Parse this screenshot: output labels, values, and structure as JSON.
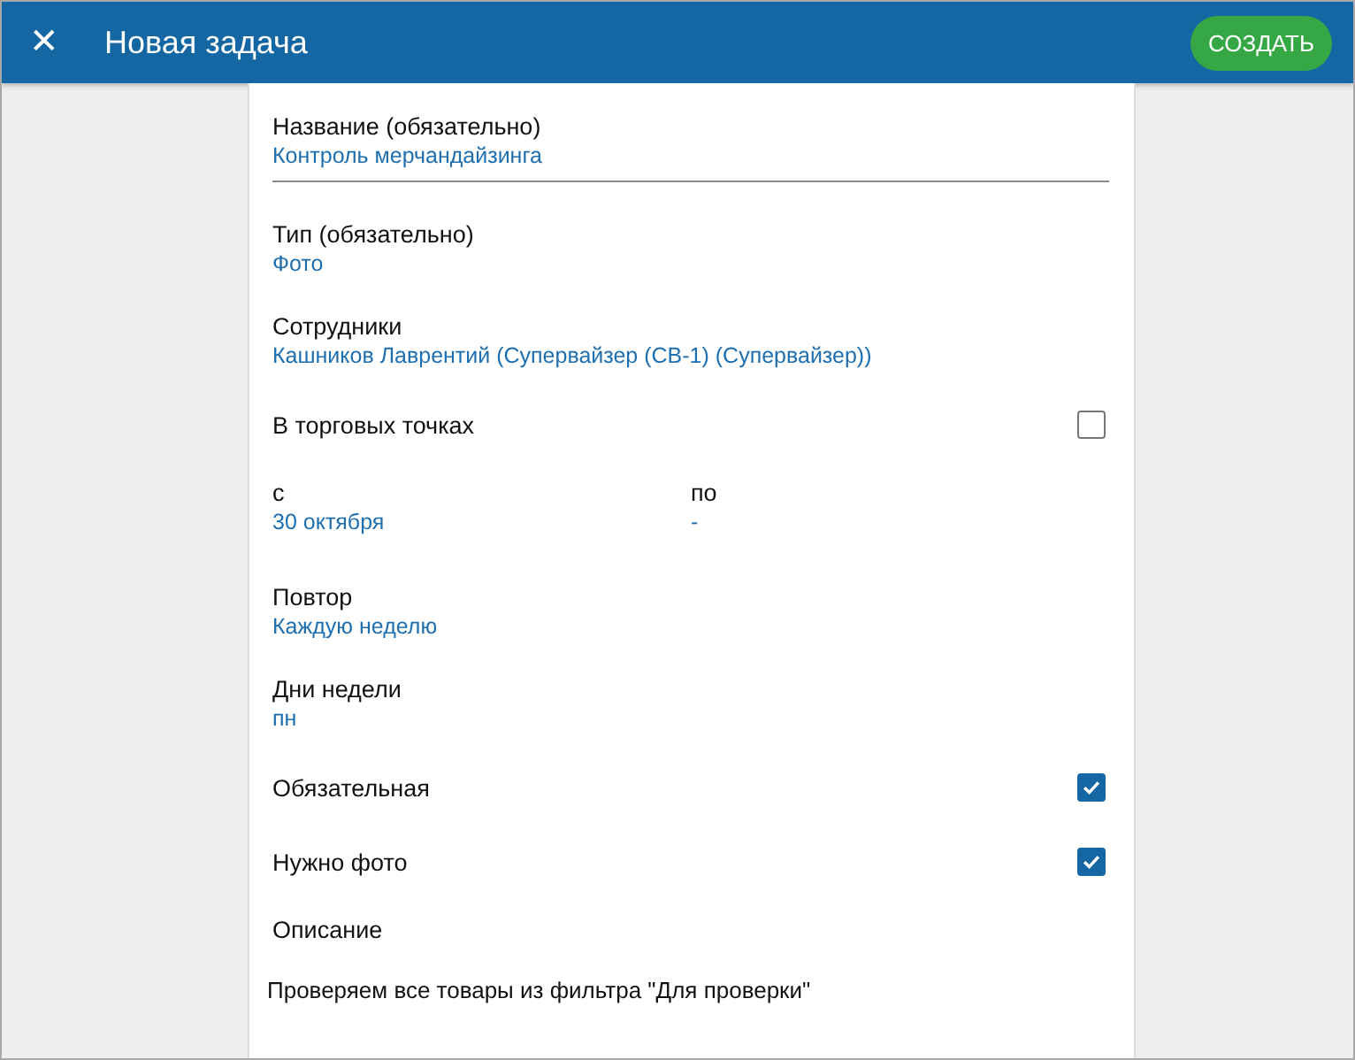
{
  "header": {
    "close": "✕",
    "title": "Новая задача",
    "action": "СОЗДАТЬ"
  },
  "fields": [
    {
      "kind": "text_field",
      "label": "Название (обязательно)",
      "value": "Контроль мерчандайзинга"
    },
    {
      "kind": "value",
      "label": "Тип (обязательно)",
      "value": "Фото"
    },
    {
      "kind": "value",
      "label": "Сотрудники",
      "value": "Кашников Лаврентий (Супервайзер (СВ-1) (Супервайзер))"
    },
    {
      "kind": "checkbox",
      "label": "В торговых точках",
      "checked": false
    },
    {
      "kind": "date_range",
      "from_label": "с",
      "from_value": "30 октября",
      "to_label": "по",
      "to_value": "-"
    },
    {
      "kind": "value",
      "label": "Повтор",
      "value": "Каждую неделю"
    },
    {
      "kind": "value",
      "label": "Дни недели",
      "value": "пн"
    },
    {
      "kind": "checkbox",
      "label": "Обязательная",
      "checked": true
    },
    {
      "kind": "checkbox",
      "label": "Нужно фото",
      "checked": true
    },
    {
      "kind": "description",
      "label": "Описание",
      "value": "Проверяем все товары из фильтра \"Для проверки\""
    }
  ]
}
